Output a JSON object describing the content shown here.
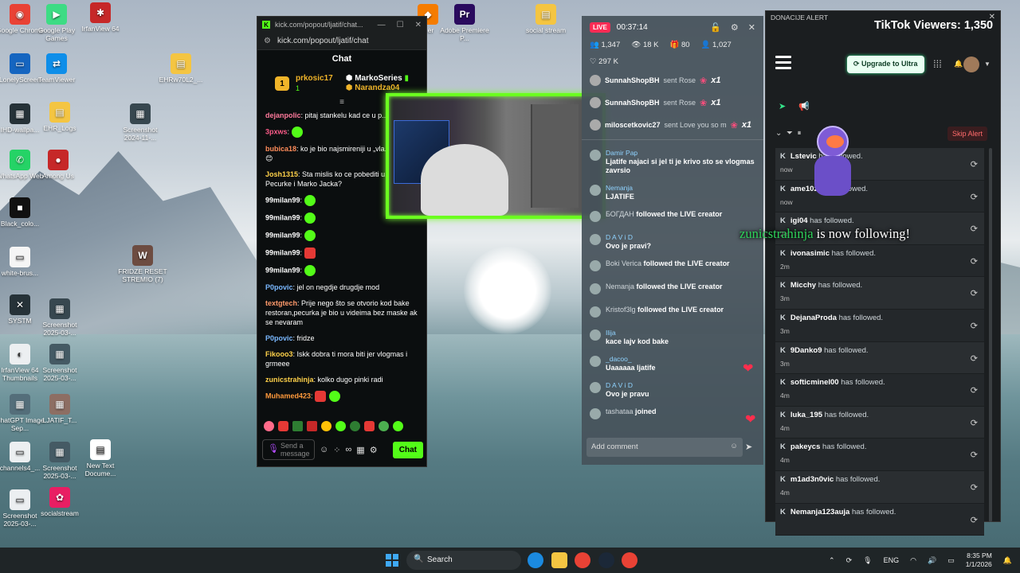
{
  "desktop": {
    "icons": [
      {
        "label": "Google Chrome",
        "color": "#e94235",
        "glyph": "◉"
      },
      {
        "label": "Google Play Games",
        "color": "#3ddc84",
        "glyph": "▶"
      },
      {
        "label": "IrfanView 64",
        "color": "#c62828",
        "glyph": "✱"
      },
      {
        "label": "LonelyScreen",
        "color": "#1565c0",
        "glyph": "▭"
      },
      {
        "label": "TeamViewer",
        "color": "#0e8ee9",
        "glyph": "⇄"
      },
      {
        "label": "EHRw70L2_...",
        "color": "#f4c542",
        "glyph": "▤"
      },
      {
        "label": "IHD-wallpa...",
        "color": "#263238",
        "glyph": "▦"
      },
      {
        "label": "EHR_Logs",
        "color": "#f4c542",
        "glyph": "▤"
      },
      {
        "label": "Screenshot 2024-11-...",
        "color": "#37474f",
        "glyph": "▦"
      },
      {
        "label": "WhatsApp Web",
        "color": "#25d366",
        "glyph": "✆"
      },
      {
        "label": "Among Us",
        "color": "#c62828",
        "glyph": "●"
      },
      {
        "label": "Black_colo...",
        "color": "#111111",
        "glyph": "■"
      },
      {
        "label": "white-brus...",
        "color": "#f5f5f5",
        "glyph": "▭"
      },
      {
        "label": "FRIDZE RESET STREMIO (7)",
        "color": "#6d4c41",
        "glyph": "W"
      },
      {
        "label": "SYSTM",
        "color": "#263238",
        "glyph": "✕"
      },
      {
        "label": "Screenshot 2025-03-...",
        "color": "#37474f",
        "glyph": "▦"
      },
      {
        "label": "IrfanView 64 Thumbnails",
        "color": "#eceff1",
        "glyph": "◐"
      },
      {
        "label": "Screenshot 2025-03-...",
        "color": "#455a64",
        "glyph": "▦"
      },
      {
        "label": "ChatGPT Image Sep...",
        "color": "#546e7a",
        "glyph": "▦"
      },
      {
        "label": "LJATIF_T...",
        "color": "#8d6e63",
        "glyph": "▦"
      },
      {
        "label": "channels4_...",
        "color": "#eceff1",
        "glyph": "▭"
      },
      {
        "label": "Screenshot 2025-03-...",
        "color": "#455a64",
        "glyph": "▦"
      },
      {
        "label": "New Text Docume...",
        "color": "#ffffff",
        "glyph": "▤"
      },
      {
        "label": "Screenshot 2025-03-...",
        "color": "#eceff1",
        "glyph": "▭"
      },
      {
        "label": "socialstream",
        "color": "#e91e63",
        "glyph": "✿"
      },
      {
        "label": "...er",
        "color": "#f57c00",
        "glyph": "◆"
      },
      {
        "label": "Adobe Premiere P...",
        "color": "#2a0a5e",
        "glyph": "Pr"
      },
      {
        "label": "social stream",
        "color": "#f4c542",
        "glyph": "▤"
      }
    ]
  },
  "kick": {
    "title": "kick.com/popout/ljatif/chat...",
    "url": "kick.com/popout/ljatif/chat",
    "header": "Chat",
    "leaderboard": [
      {
        "rank": "1",
        "name": "prkosic17",
        "count": "1"
      },
      {
        "name": "MarkoSeries",
        "count": "1"
      },
      {
        "name": "Narandza04",
        "count": ""
      }
    ],
    "messages": [
      {
        "user": "dejanpolic",
        "color": "#ff7a9c",
        "text": "pitaj stankelu kad ce u p..."
      },
      {
        "user": "3pxws",
        "color": "#ff5c8a",
        "text": ""
      },
      {
        "user": "bubica18",
        "color": "#ff8c5a",
        "text": "ko je bio najsmireniji u „vla... grupi\"? 😊"
      },
      {
        "user": "Josh1315",
        "color": "#ffd24a",
        "text": "Sta mislis ko ce pobediti u... izmedju Pecurke i Marko Jacka?"
      },
      {
        "user": "99milan99",
        "color": "#ffffff",
        "text": ""
      },
      {
        "user": "99milan99",
        "color": "#ffffff",
        "text": ""
      },
      {
        "user": "99milan99",
        "color": "#ffffff",
        "text": ""
      },
      {
        "user": "99milan99",
        "color": "#ffffff",
        "text": ""
      },
      {
        "user": "99milan99",
        "color": "#ffffff",
        "text": ""
      },
      {
        "user": "P0povic",
        "color": "#7ab8ff",
        "text": "jel on negdje drugdje mod"
      },
      {
        "user": "textgtech",
        "color": "#ff9a6b",
        "text": "Prije nego što se otvorio kod bake restoran,pecurka je bio u videima bez maske ak se nevaram"
      },
      {
        "user": "P0povic",
        "color": "#7ab8ff",
        "text": "fridze"
      },
      {
        "user": "Fikooo3",
        "color": "#ffd24a",
        "text": "Iskk dobra ti mora biti jer vlogmas i grmeee"
      },
      {
        "user": "zunicstrahinja",
        "color": "#ffd24a",
        "text": "kolko dugo pinki radi"
      },
      {
        "user": "Muhamed423",
        "color": "#ff9a3c",
        "text": ""
      }
    ],
    "input_placeholder": "Send a message",
    "send_label": "Chat"
  },
  "tiktok": {
    "live_label": "LIVE",
    "timer": "00:37:14",
    "stats": [
      "1,347",
      "18 K",
      "80",
      "1,027"
    ],
    "likes": "297 K",
    "gifts": [
      {
        "user": "SunnahShopBH",
        "action": "sent Rose",
        "count": "x1"
      },
      {
        "user": "SunnahShopBH",
        "action": "sent Rose",
        "count": "x1"
      },
      {
        "user": "milosсetkovic27",
        "action": "sent Love you so m",
        "count": "x1"
      }
    ],
    "comments": [
      {
        "name": "Damir Pap",
        "text": "Ljatife najaci si jel ti je krivo sto se vlogmas zavrsio"
      },
      {
        "name": "Nemanja",
        "text": "LJATIFE"
      },
      {
        "name": "БОГДАН",
        "text": "followed the LIVE creator",
        "inline": true
      },
      {
        "name": "D A V i D",
        "text": "Ovo je pravi?"
      },
      {
        "name": "Boki Verica",
        "text": "followed the LIVE creator",
        "inline": true
      },
      {
        "name": "Nemanja",
        "text": "followed the LIVE creator",
        "inline": true
      },
      {
        "name": "Kristof3lg",
        "text": "followed the LIVE creator",
        "inline": true
      },
      {
        "name": "Ilija",
        "text": "kace lajv kod bake"
      },
      {
        "name": "_dacoo_",
        "text": "Uaaaaaa ljatife"
      },
      {
        "name": "D A V i D",
        "text": "Ovo je pravu"
      },
      {
        "name": "tashataa",
        "text": "joined",
        "inline": true
      }
    ],
    "comment_placeholder": "Add comment"
  },
  "donation": {
    "window_title": "DONACIJE ALERT",
    "viewers": "TikTok Viewers: 1,350",
    "upgrade_label": "Upgrade to Ultra",
    "skip_label": "Skip Alert",
    "followers": [
      {
        "name": "Lstevic",
        "action": "has followed.",
        "time": "now"
      },
      {
        "name": "ame10zz",
        "action": "has followed.",
        "time": "now"
      },
      {
        "name": "igi04",
        "action": "has followed.",
        "time": "2m"
      },
      {
        "name": "ivonasimic",
        "action": "has followed.",
        "time": "2m"
      },
      {
        "name": "Micchy",
        "action": "has followed.",
        "time": "3m"
      },
      {
        "name": "DejanaProda",
        "action": "has followed.",
        "time": "3m"
      },
      {
        "name": "9Danko9",
        "action": "has followed.",
        "time": "3m"
      },
      {
        "name": "softicminel00",
        "action": "has followed.",
        "time": "4m"
      },
      {
        "name": "luka_195",
        "action": "has followed.",
        "time": "4m"
      },
      {
        "name": "pakeycs",
        "action": "has followed.",
        "time": "4m"
      },
      {
        "name": "m1ad3n0vic",
        "action": "has followed.",
        "time": "4m"
      },
      {
        "name": "Nemanja123auja",
        "action": "has followed.",
        "time": ""
      }
    ],
    "overlay_user": "zunicstrahinja",
    "overlay_text": "is now following!"
  },
  "taskbar": {
    "search_placeholder": "Search",
    "language": "ENG",
    "time": "8:35 PM",
    "date": "1/1/2026"
  }
}
